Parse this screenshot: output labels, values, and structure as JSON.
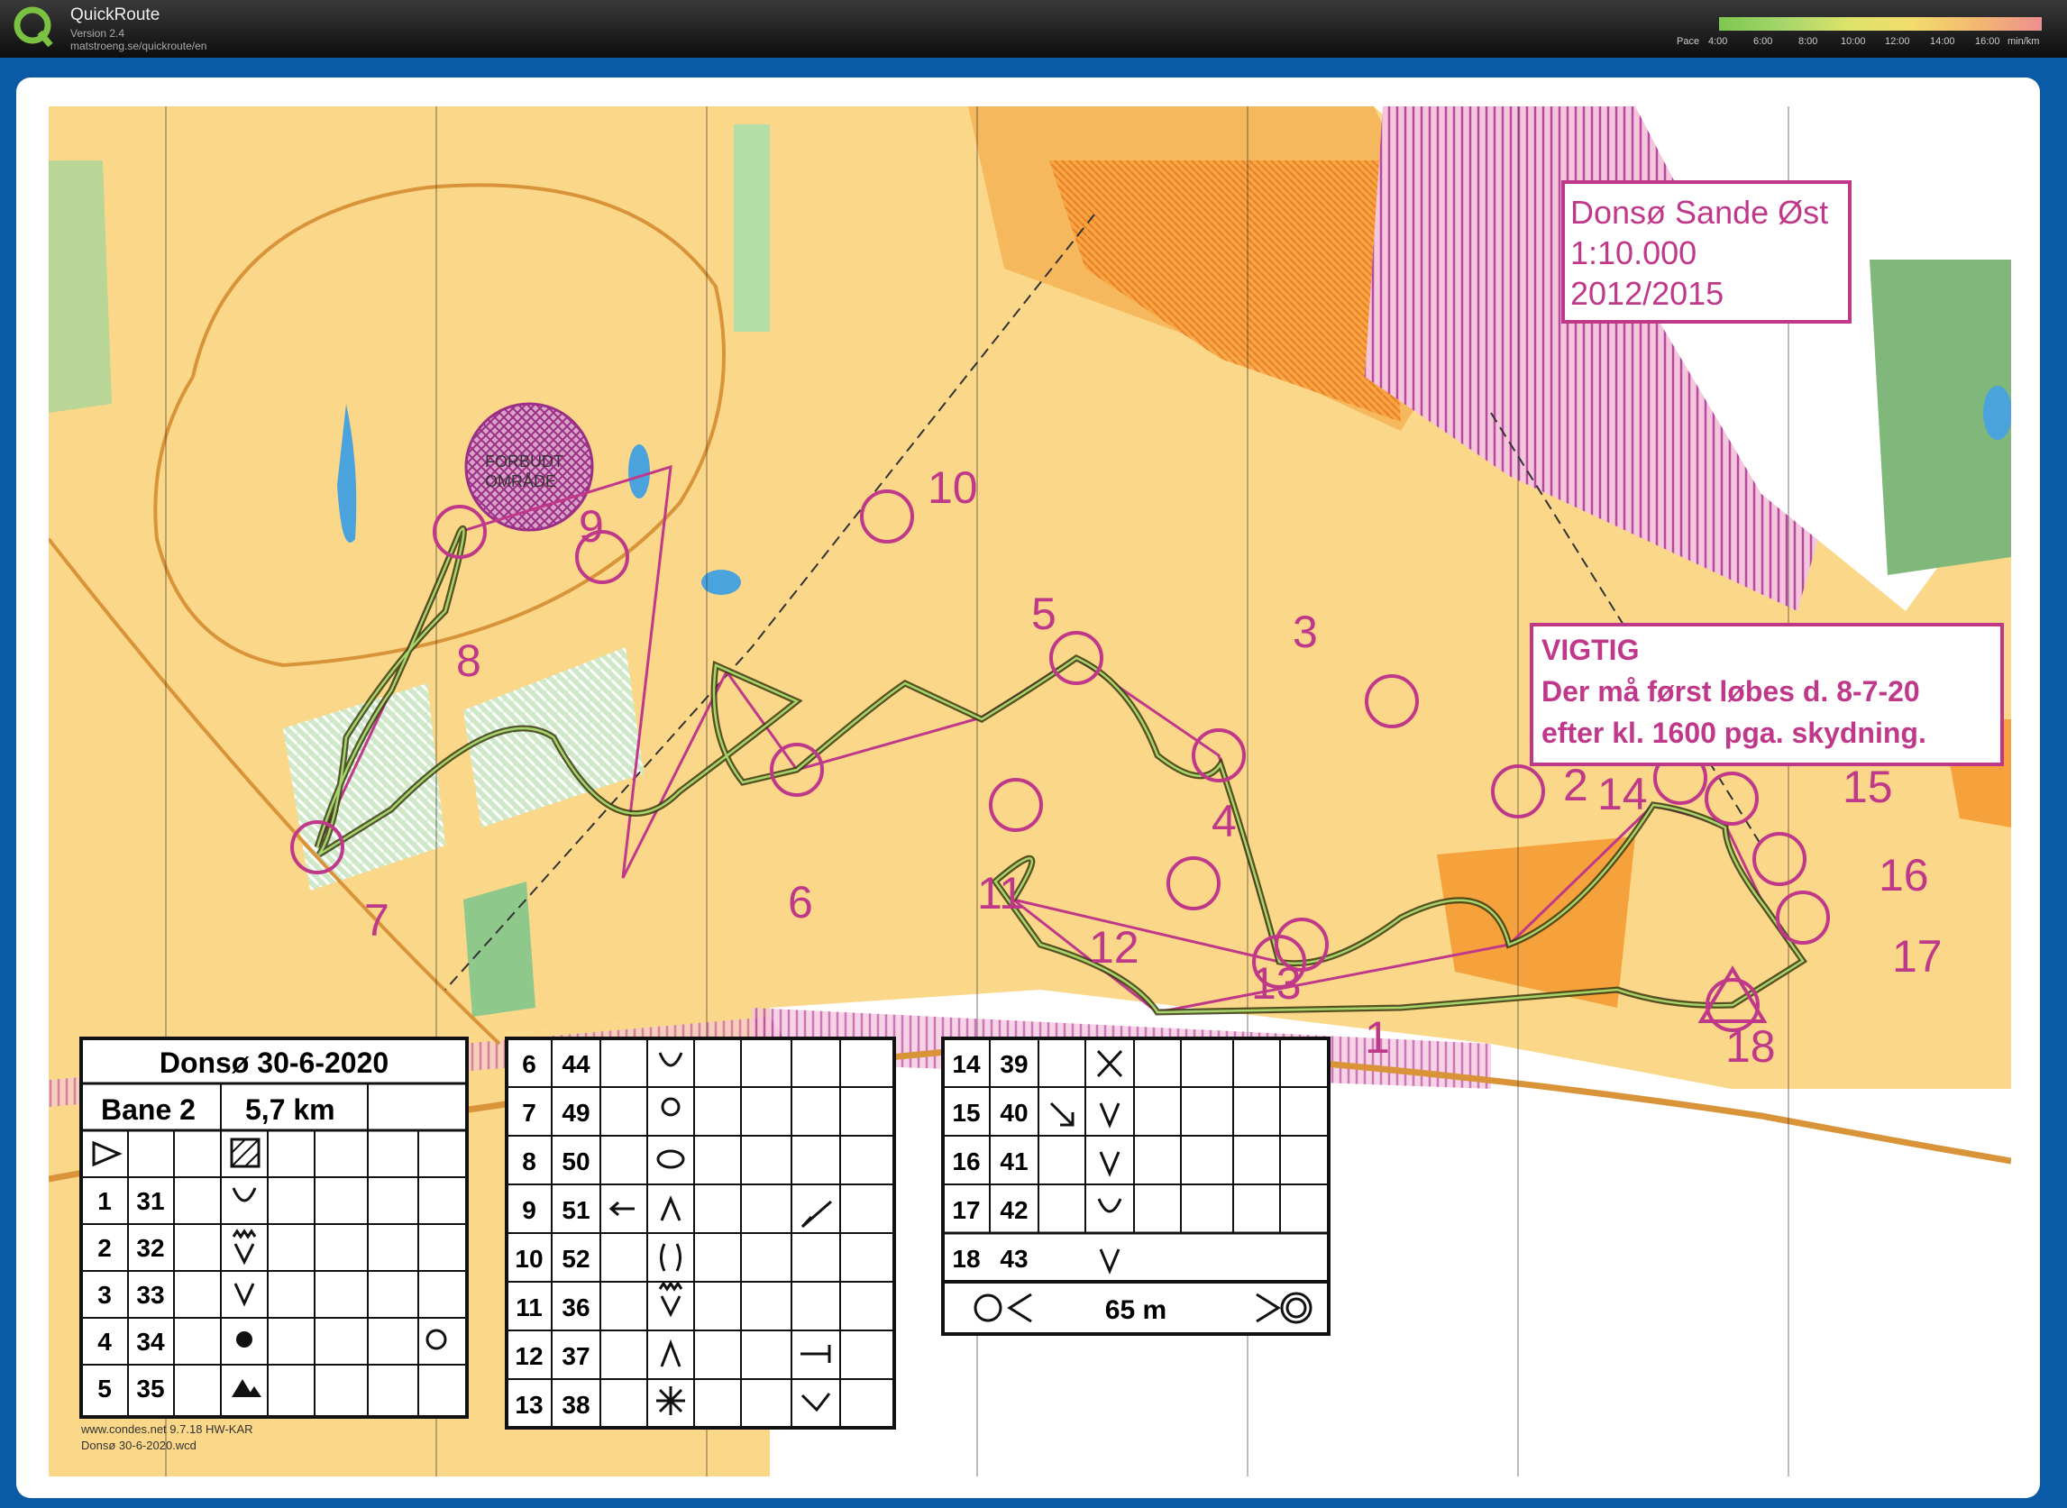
{
  "app": {
    "title": "QuickRoute",
    "version": "Version 2.4",
    "url": "matstroeng.se/quickroute/en",
    "logo_letter": "Q"
  },
  "pace_legend": {
    "label": "Pace",
    "ticks": [
      "4:00",
      "6:00",
      "8:00",
      "10:00",
      "12:00",
      "14:00",
      "16:00"
    ],
    "unit": "min/km"
  },
  "map": {
    "forbidden_area": [
      "FORBUDT",
      "OMRÅDE"
    ],
    "title_box": [
      "Donsø Sande Øst",
      "1:10.000",
      "2012/2015"
    ],
    "notice": [
      "VIGTIG",
      "Der må først løbes d. 8-7-20",
      "efter kl. 1600 pga. skydning."
    ],
    "controls": [
      "1",
      "2",
      "3",
      "4",
      "5",
      "6",
      "7",
      "8",
      "9",
      "10",
      "11",
      "12",
      "13",
      "14",
      "15",
      "16",
      "17",
      "18"
    ],
    "footer": [
      "www.condes.net 9.7.18 HW-KAR",
      "Donsø 30-6-2020.wcd"
    ],
    "colors": {
      "course": "#c0388a",
      "route": "#3a3a10",
      "open_land": "#fbd889",
      "rough": "#f6b85c",
      "forest_green": "#8fc88b",
      "out_of_bounds": "#b848a0"
    }
  },
  "description": {
    "event": "Donsø 30-6-2020",
    "course": "Bane 2",
    "length": "5,7 km",
    "rows_left": [
      {
        "n": "1",
        "code": "31"
      },
      {
        "n": "2",
        "code": "32"
      },
      {
        "n": "3",
        "code": "33"
      },
      {
        "n": "4",
        "code": "34"
      },
      {
        "n": "5",
        "code": "35"
      }
    ],
    "rows_middle": [
      {
        "n": "6",
        "code": "44"
      },
      {
        "n": "7",
        "code": "49"
      },
      {
        "n": "8",
        "code": "50"
      },
      {
        "n": "9",
        "code": "51"
      },
      {
        "n": "10",
        "code": "52"
      },
      {
        "n": "11",
        "code": "36"
      },
      {
        "n": "12",
        "code": "37"
      },
      {
        "n": "13",
        "code": "38"
      }
    ],
    "rows_right": [
      {
        "n": "14",
        "code": "39"
      },
      {
        "n": "15",
        "code": "40"
      },
      {
        "n": "16",
        "code": "41"
      },
      {
        "n": "17",
        "code": "42"
      },
      {
        "n": "18",
        "code": "43"
      }
    ],
    "finish_distance": "65 m"
  }
}
